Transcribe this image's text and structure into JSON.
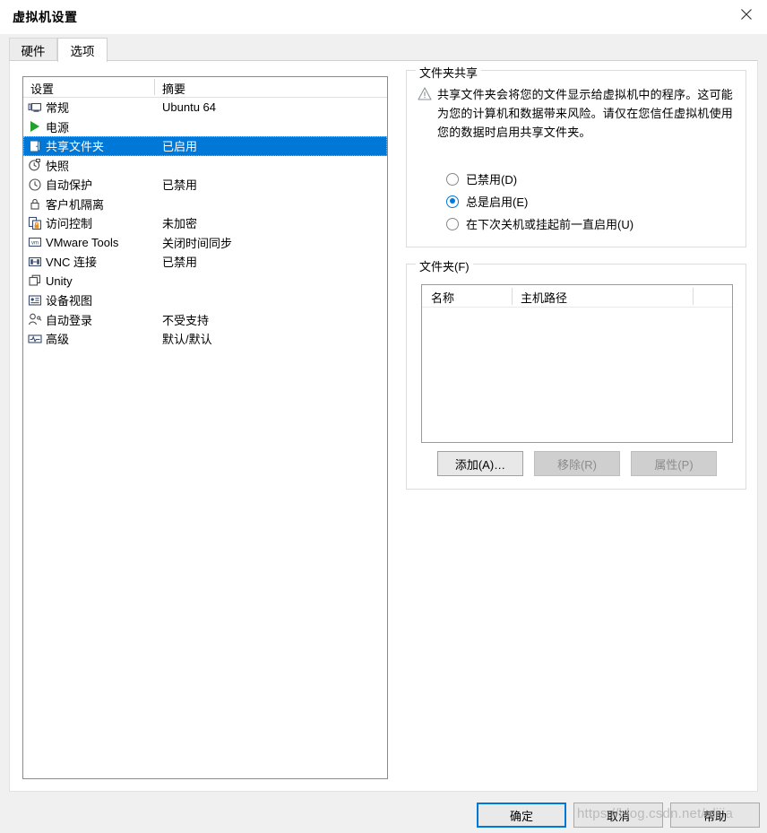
{
  "window": {
    "title": "虚拟机设置",
    "close_label": "×"
  },
  "tabs": [
    {
      "id": "hardware",
      "label": "硬件",
      "active": false
    },
    {
      "id": "options",
      "label": "选项",
      "active": true
    }
  ],
  "settings_list": {
    "columns": {
      "name": "设置",
      "summary": "摘要"
    },
    "rows": [
      {
        "icon": "monitor-icon",
        "label": "常规",
        "summary": "Ubuntu 64",
        "selected": false
      },
      {
        "icon": "power-play-icon",
        "label": "电源",
        "summary": "",
        "selected": false
      },
      {
        "icon": "shared-folder-icon",
        "label": "共享文件夹",
        "summary": "已启用",
        "selected": true
      },
      {
        "icon": "snapshot-icon",
        "label": "快照",
        "summary": "",
        "selected": false
      },
      {
        "icon": "autoprotect-icon",
        "label": "自动保护",
        "summary": "已禁用",
        "selected": false
      },
      {
        "icon": "lock-icon",
        "label": "客户机隔离",
        "summary": "",
        "selected": false
      },
      {
        "icon": "access-control-icon",
        "label": "访问控制",
        "summary": "未加密",
        "selected": false
      },
      {
        "icon": "vmware-tools-icon",
        "label": "VMware Tools",
        "summary": "关闭时间同步",
        "selected": false
      },
      {
        "icon": "vnc-icon",
        "label": "VNC 连接",
        "summary": "已禁用",
        "selected": false
      },
      {
        "icon": "unity-icon",
        "label": "Unity",
        "summary": "",
        "selected": false
      },
      {
        "icon": "device-view-icon",
        "label": "设备视图",
        "summary": "",
        "selected": false
      },
      {
        "icon": "autologon-icon",
        "label": "自动登录",
        "summary": "不受支持",
        "selected": false
      },
      {
        "icon": "advanced-icon",
        "label": "高级",
        "summary": "默认/默认",
        "selected": false
      }
    ]
  },
  "folder_sharing": {
    "group_title": "文件夹共享",
    "warning_icon": "warning-triangle-icon",
    "warning_text": "共享文件夹会将您的文件显示给虚拟机中的程序。这可能为您的计算机和数据带来风险。请仅在您信任虚拟机使用您的数据时启用共享文件夹。",
    "options": [
      {
        "label": "已禁用(D)",
        "checked": false
      },
      {
        "label": "总是启用(E)",
        "checked": true
      },
      {
        "label": "在下次关机或挂起前一直启用(U)",
        "checked": false
      }
    ]
  },
  "folders": {
    "group_title": "文件夹(F)",
    "columns": [
      "名称",
      "主机路径",
      ""
    ],
    "rows": [],
    "buttons": [
      {
        "label": "添加(A)…",
        "disabled": false
      },
      {
        "label": "移除(R)",
        "disabled": true
      },
      {
        "label": "属性(P)",
        "disabled": true
      }
    ]
  },
  "dialog_buttons": [
    {
      "id": "ok",
      "label": "确定",
      "default": true
    },
    {
      "id": "cancel",
      "label": "取消",
      "default": false
    },
    {
      "id": "help",
      "label": "帮助",
      "default": false
    }
  ],
  "watermark": "https://blog.csdn.net/nlijia",
  "colors": {
    "selection_blue": "#0078d7",
    "accent_blue": "#0078d7",
    "window_bg": "#f0f0f0",
    "panel_bg": "#ffffff"
  }
}
